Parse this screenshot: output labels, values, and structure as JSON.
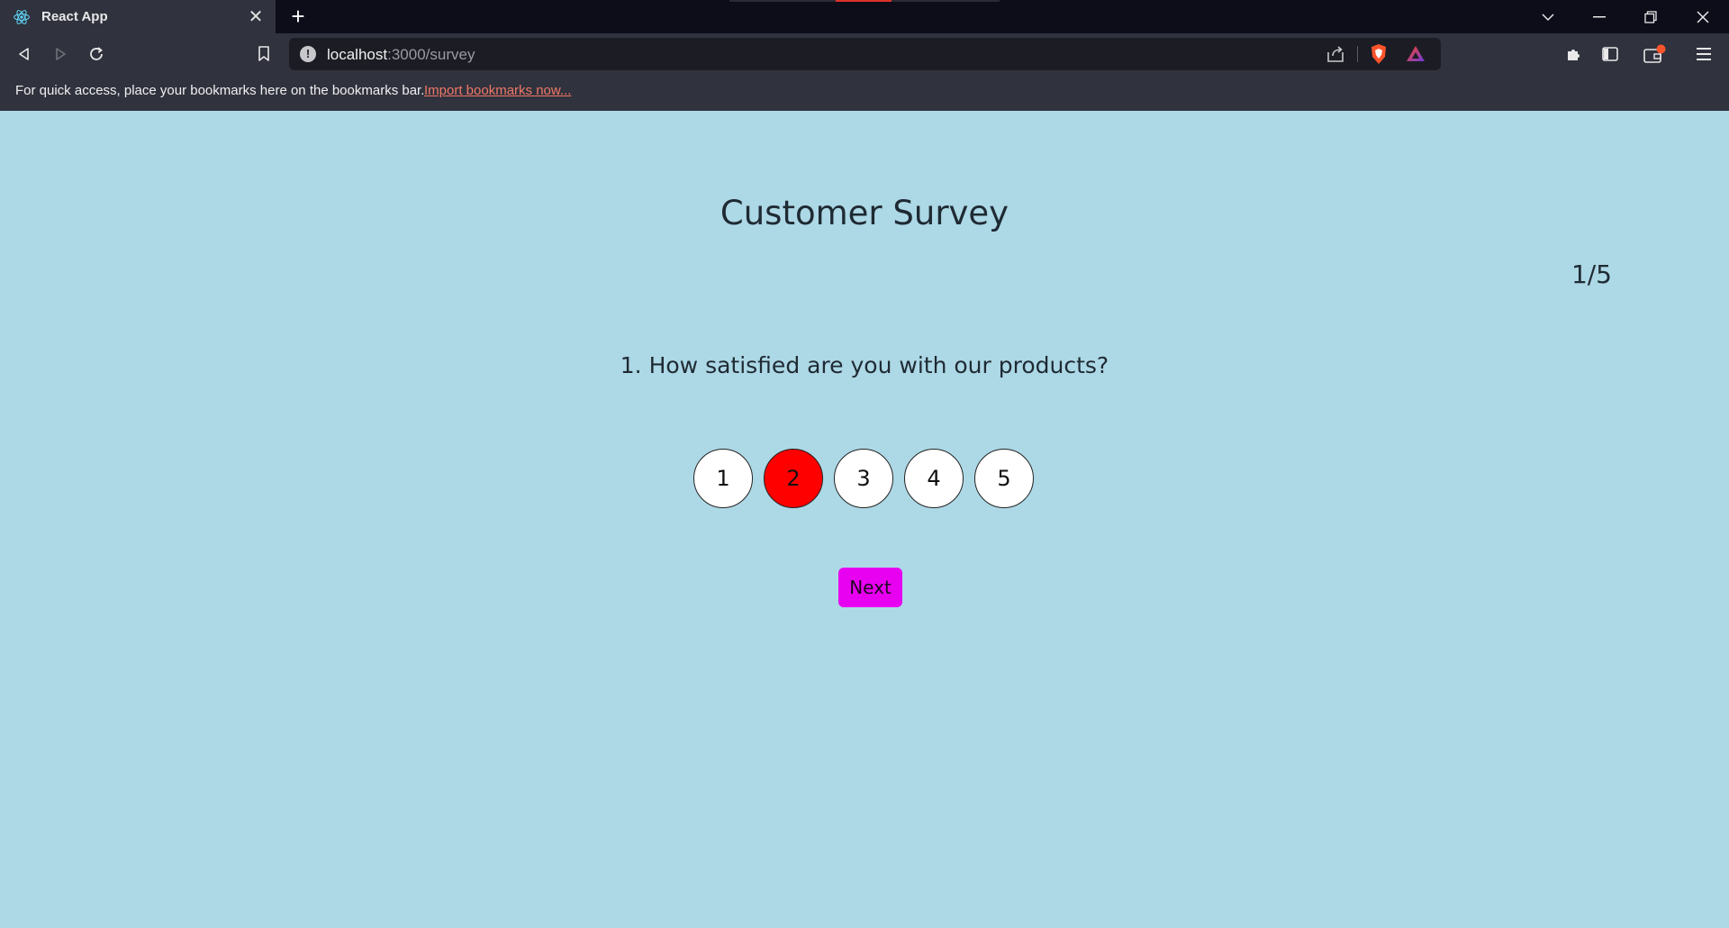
{
  "browser": {
    "tab_title": "React App",
    "tab_close": "✕",
    "new_tab": "+",
    "url_host": "localhost",
    "url_path": ":3000/survey",
    "bookmarks_message": "For quick access, place your bookmarks here on the bookmarks bar.",
    "bookmarks_link": "Import bookmarks now...",
    "icons": {
      "tab": "react-icon",
      "back": "back-arrow-icon",
      "forward": "forward-arrow-icon",
      "reload": "reload-icon",
      "bookmark": "bookmark-icon",
      "site_info": "info-icon",
      "share": "share-icon",
      "shields": "brave-shields-icon",
      "rewards": "brave-rewards-icon",
      "extensions": "puzzle-icon",
      "sidebar": "sidebar-icon",
      "wallet": "wallet-icon",
      "menu": "hamburger-menu-icon"
    }
  },
  "survey": {
    "title": "Customer Survey",
    "progress": "1/5",
    "question": "1. How satisfied are you with our products?",
    "ratings": [
      "1",
      "2",
      "3",
      "4",
      "5"
    ],
    "selected_rating": "2",
    "next_label": "Next"
  },
  "colors": {
    "page_background": "#add8e6",
    "selected_rating": "#ff0000",
    "next_button": "#e800f0",
    "link": "#f07868"
  }
}
